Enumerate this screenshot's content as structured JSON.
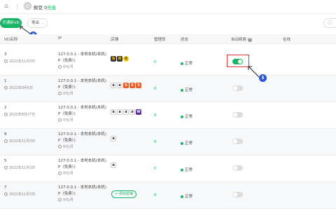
{
  "topbar": {
    "home_icon": "home-icon",
    "beans": "鲜豆 0",
    "recharge": "充值"
  },
  "toolbar": {
    "open_vd_label": "开通新VD",
    "export_label": "导出",
    "search_icon": "search-icon"
  },
  "table": {
    "headers": {
      "name": "VD名称",
      "ip": "IP",
      "stores": "店铺",
      "manager": "管理员",
      "status": "状态",
      "autorenew": "自动续费",
      "online": "在线"
    },
    "rows": [
      {
        "id": "3",
        "date": "2022年11月3日",
        "ip_line1": "127.0.0.1 - 本地本机(本机)",
        "ip_line2": "P（免费）)",
        "price": "0元/月",
        "stores": [
          "淘",
          "商",
          "Q"
        ],
        "manager": "0",
        "status": "正常",
        "autorenew": true
      },
      {
        "id": "1",
        "date": "2022年9月6日",
        "ip_line1": "127.0.0.1 - 本地本机(本机)",
        "ip_line2": "P（免费）)",
        "price": "0元/月",
        "stores": [
          "a",
          "a",
          "S",
          "S",
          "S"
        ],
        "manager": "0",
        "status": "正常",
        "autorenew": false
      },
      {
        "id": "2",
        "date": "2022年8月27日",
        "ip_line1": "127.0.0.1 - 本地本机(本机)",
        "ip_line2": "P（免费）)",
        "price": "0元/月",
        "stores": [
          "a",
          "a",
          "a",
          "a",
          "W"
        ],
        "manager": "0",
        "status": "正常",
        "autorenew": false
      },
      {
        "id": "8",
        "date": "2022年11月3日",
        "ip_line1": "127.0.0.1 - 本地本机(本机)",
        "ip_line2": "P（免费）)",
        "price": "0元/月",
        "stores": [
          "a"
        ],
        "manager": "0",
        "status": "正常",
        "autorenew": false
      },
      {
        "id": "5",
        "date": "2022年11月3日",
        "ip_line1": "127.0.0.1 - 本地本机(本机)",
        "ip_line2": "P（免费）)",
        "price": "0元/月",
        "stores": [
          "a"
        ],
        "manager": "0",
        "status": "正常",
        "autorenew": false
      },
      {
        "id": "7",
        "date": "2022年11月3日",
        "ip_line1": "127.0.0.1 - 本地本机(本机)",
        "ip_line2": "P（免费）)",
        "price": "0元/月",
        "stores": [],
        "add_store": "添加店铺",
        "manager": "0",
        "status": "正常",
        "autorenew": false
      }
    ]
  },
  "annotations": {
    "badge_3": "3",
    "badge_5": "5"
  },
  "colors": {
    "accent": "#18b566",
    "badge": "#2b57d6",
    "highlight": "#e03030"
  }
}
